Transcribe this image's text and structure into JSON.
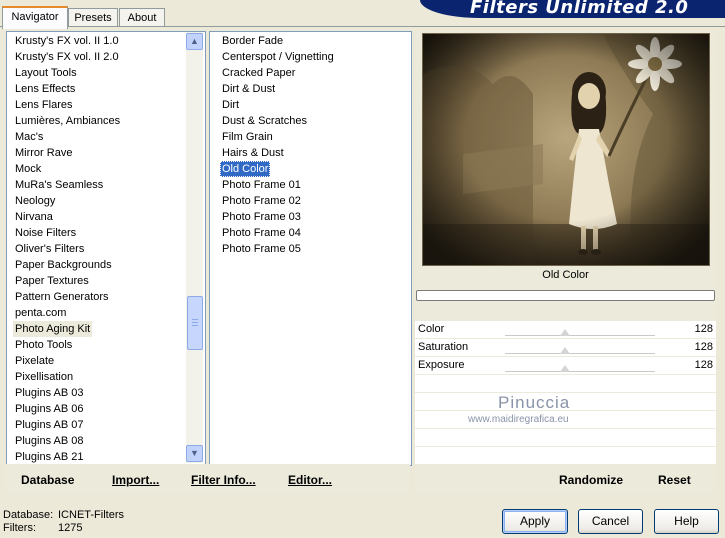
{
  "tabs": [
    "Navigator",
    "Presets",
    "About"
  ],
  "banner_title": "Filters Unlimited 2.0",
  "categories": [
    "Krusty's FX vol. II 1.0",
    "Krusty's FX vol. II 2.0",
    "Layout Tools",
    "Lens Effects",
    "Lens Flares",
    "Lumières, Ambiances",
    "Mac's",
    "Mirror Rave",
    "Mock",
    "MuRa's Seamless",
    "Neology",
    "Nirvana",
    "Noise Filters",
    "Oliver's Filters",
    "Paper Backgrounds",
    "Paper Textures",
    "Pattern Generators",
    "penta.com",
    "Photo Aging Kit",
    "Photo Tools",
    "Pixelate",
    "Pixellisation",
    "Plugins AB 03",
    "Plugins AB 06",
    "Plugins AB 07",
    "Plugins AB 08",
    "Plugins AB 21"
  ],
  "selected_category": "Photo Aging Kit",
  "filters": [
    "Border Fade",
    "Centerspot / Vignetting",
    "Cracked Paper",
    "Dirt & Dust",
    "Dirt",
    "Dust & Scratches",
    "Film Grain",
    "Hairs & Dust",
    "Old Color",
    "Photo Frame 01",
    "Photo Frame 02",
    "Photo Frame 03",
    "Photo Frame 04",
    "Photo Frame 05"
  ],
  "selected_filter": "Old Color",
  "preview_title": "Old Color",
  "progress": 0,
  "sliders": [
    {
      "label": "Color",
      "value": "128"
    },
    {
      "label": "Saturation",
      "value": "128"
    },
    {
      "label": "Exposure",
      "value": "128"
    }
  ],
  "watermark": {
    "name": "Pinuccia",
    "url": "www.maidiregrafica.eu"
  },
  "left_links": {
    "database": "Database",
    "import": "Import...",
    "filter_info": "Filter Info...",
    "editor": "Editor..."
  },
  "right_links": {
    "randomize": "Randomize",
    "reset": "Reset"
  },
  "status": {
    "database_label": "Database:",
    "database_value": "ICNET-Filters",
    "filters_label": "Filters:",
    "filters_value": "1275"
  },
  "buttons": {
    "apply": "Apply",
    "cancel": "Cancel",
    "help": "Help"
  },
  "colors": {
    "selection": "#316ac5",
    "banner": "#0a2470",
    "tab_accent": "#e68b2c"
  }
}
